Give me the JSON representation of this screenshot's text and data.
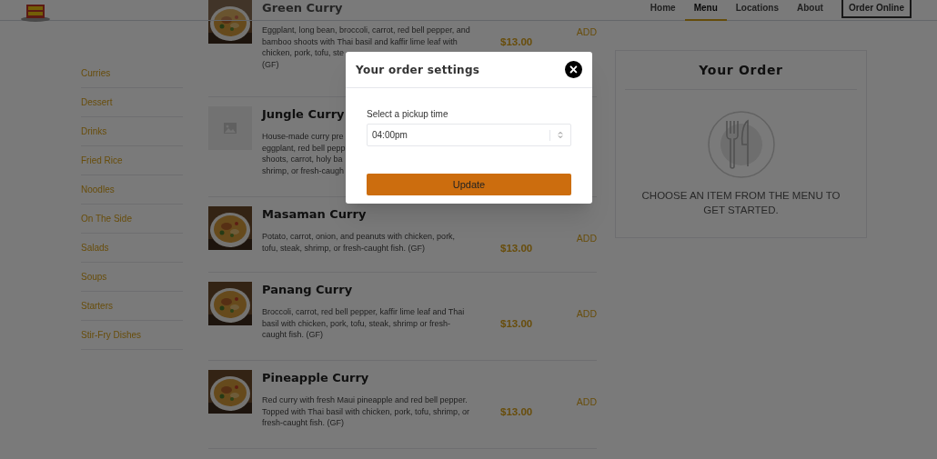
{
  "header": {
    "nav": [
      {
        "label": "Home",
        "selected": false
      },
      {
        "label": "Menu",
        "selected": true
      },
      {
        "label": "Locations",
        "selected": false
      },
      {
        "label": "About",
        "selected": false
      }
    ],
    "cta": "Order Online"
  },
  "categories": [
    "Curries",
    "Dessert",
    "Drinks",
    "Fried Rice",
    "Noodles",
    "On The Side",
    "Salads",
    "Soups",
    "Starters",
    "Stir-Fry Dishes"
  ],
  "items": [
    {
      "name": "Green Curry",
      "description_lines": [
        "Eggplant, long bean, broccoli, carrot, red bell pepper, and",
        "bamboo shoots with Thai basil and kaffir lime leaf with",
        "chicken, pork, tofu, ste",
        "(GF)"
      ],
      "price": "$13.00",
      "add": "ADD"
    },
    {
      "kind": "placeholder",
      "name": "Jungle Curry",
      "description_lines": [
        "House-made curry pre",
        "eggplant, red bell pepp",
        "shoots, carrot, holy ba",
        "shrimp, or fresh-caugh"
      ]
    },
    {
      "name": "Masaman Curry",
      "description_lines": [
        "Potato, carrot, onion, and peanuts with chicken, pork,",
        "tofu, steak, shrimp, or fresh-caught fish. (GF)"
      ],
      "price": "$13.00",
      "add": "ADD"
    },
    {
      "name": "Panang Curry",
      "description_lines": [
        "Broccoli, carrot, red bell pepper, kaffir lime leaf and Thai",
        "basil with chicken, pork, tofu, steak, shrimp or fresh-",
        "caught fish. (GF)"
      ],
      "price": "$13.00",
      "add": "ADD"
    },
    {
      "name": "Pineapple Curry",
      "description_lines": [
        "Red curry with fresh Maui pineapple and red bell pepper.",
        "Topped with Thai basil with chicken, pork, tofu, shrimp, or",
        "fresh-caught fish. (GF)"
      ],
      "price": "$13.00",
      "add": "ADD"
    }
  ],
  "order": {
    "title": "Your Order",
    "empty_message": "CHOOSE AN ITEM FROM THE MENU TO GET STARTED."
  },
  "modal": {
    "title": "Your order settings",
    "close": "×",
    "field_label": "Select a pickup time",
    "pickup_time": "04:00pm",
    "button": "Update"
  }
}
